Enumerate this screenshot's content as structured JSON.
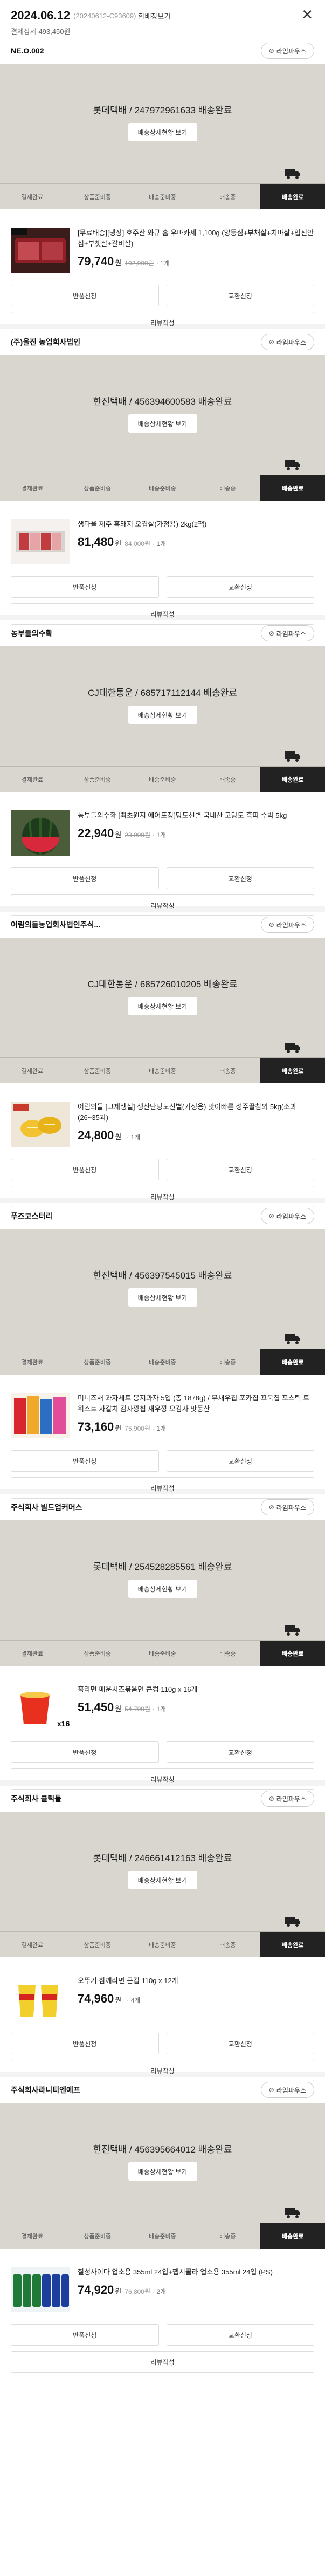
{
  "header": {
    "date": "2024.06.12",
    "order_code": "(20240612-C93609)",
    "merge_label": "합배장보기",
    "payment_summary": "결제상세 493,450원"
  },
  "labels": {
    "live_commerce": "라임파우스",
    "tracking_button": "배송상세현황 보기",
    "return": "반품신청",
    "exchange": "교환신청",
    "review": "리뷰작성",
    "unit": "원"
  },
  "steps": [
    "결제완료",
    "상품준비중",
    "배송준비중",
    "배송중",
    "배송완료"
  ],
  "orders": [
    {
      "seller": "NE.O.002",
      "carrier": "롯데택배 / 247972961633 배송완료",
      "product": "[무료배송][냉장] 호주산 와규 홈 우마카세 1,100g (양등심+부채살+치마살+업진안심+부챗살+갈비살)",
      "price": "79,740",
      "original": "102,900원",
      "qty": "· 1개",
      "thumb": "beef"
    },
    {
      "seller": "(주)울진 농업회사법인",
      "carrier": "한진택배 / 456394600583 배송완료",
      "product": "생다을 제주 흑돼지 오겹살(가정용) 2kg(2팩)",
      "price": "81,480",
      "original": "84,000원",
      "qty": "· 1개",
      "thumb": "pork"
    },
    {
      "seller": "농부들의수확",
      "carrier": "CJ대한통운 / 685717112144 배송완료",
      "product": "농부들의수확 [최초원지 에어포장]당도선별 국내산 고당도 흑피 수박 5kg",
      "price": "22,940",
      "original": "23,900원",
      "qty": "· 1개",
      "thumb": "melon"
    },
    {
      "seller": "어림의들농업회사법인주식...",
      "carrier": "CJ대한통운 / 685726010205 배송완료",
      "product": "어림의들 [고제생실] 생산단당도선별(가정용) 맛이빠른 성주꿀참외 5kg(소과(26~35과)",
      "price": "24,800",
      "original": "",
      "qty": "· 1개",
      "thumb": "fruit"
    },
    {
      "seller": "푸즈코스터리",
      "carrier": "한진택배 / 456397545015 배송완료",
      "product": "미니즈새 과자세트 봉지과자 5입 (총 1878g) / 무새우칩 포카칩 꼬북칩 포스틱 트위스트 자갈치 감자깡칩 새우깡 오감자 맛동산",
      "price": "73,160",
      "original": "75,900원",
      "qty": "· 1개",
      "thumb": "snack"
    },
    {
      "seller": "주식회사 빌드업커머스",
      "carrier": "롯데택배 / 254528285561 배송완료",
      "product": "홈라면 매운치즈볶음면 큰컵 110g x 16개",
      "price": "51,450",
      "original": "54,700원",
      "qty": "· 1개",
      "thumb": "ramen"
    },
    {
      "seller": "주식회사 클릭톨",
      "carrier": "롯데택배 / 246661412163 배송완료",
      "product": "오뚜기 참깨라면 큰컵 110g x 12개",
      "price": "74,960",
      "original": "",
      "qty": "· 4개",
      "thumb": "cup"
    },
    {
      "seller": "주식회사라니티엔에프",
      "carrier": "한진택배 / 456395664012 배송완료",
      "product": "칠성사이다 업소용 355ml 24입+펩시콜라 업소용 355ml 24입 (PS)",
      "price": "74,920",
      "original": "76,800원",
      "qty": "· 2개",
      "thumb": "cans"
    }
  ]
}
